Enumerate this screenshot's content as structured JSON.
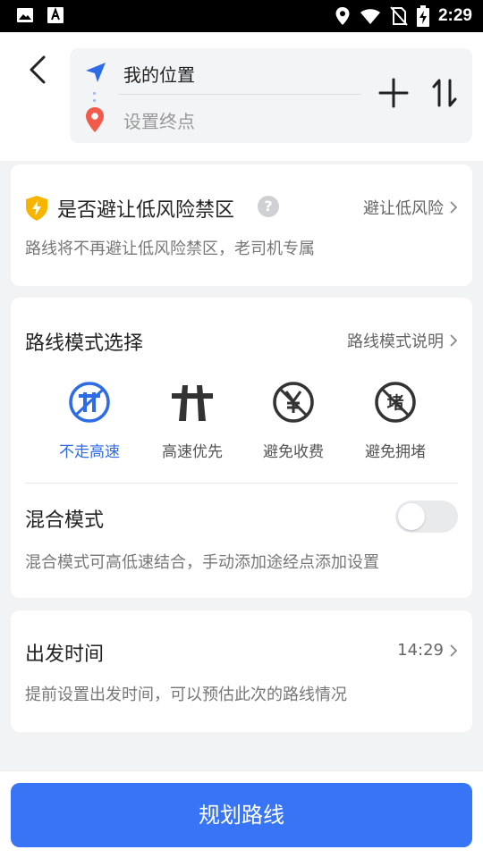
{
  "status_bar": {
    "time": "2:29",
    "icons": [
      "image-icon",
      "text-app-icon",
      "location-icon",
      "wifi-icon",
      "no-sim-icon",
      "battery-charging-icon"
    ]
  },
  "header": {
    "start": "我的位置",
    "end_placeholder": "设置终点"
  },
  "avoid_card": {
    "title": "是否避让低风险禁区",
    "help": "?",
    "link": "避让低风险",
    "desc": "路线将不再避让低风险禁区，老司机专属"
  },
  "mode_card": {
    "title": "路线模式选择",
    "link": "路线模式说明",
    "modes": [
      {
        "label": "不走高速",
        "icon": "no-highway-icon",
        "active": true
      },
      {
        "label": "高速优先",
        "icon": "highway-icon",
        "active": false
      },
      {
        "label": "避免收费",
        "icon": "no-toll-icon",
        "active": false
      },
      {
        "label": "避免拥堵",
        "icon": "no-congestion-icon",
        "active": false
      }
    ],
    "congestion_glyph": "堵",
    "mix_title": "混合模式",
    "mix_on": false,
    "mix_desc": "混合模式可高低速结合，手动添加途经点添加设置"
  },
  "depart_card": {
    "title": "出发时间",
    "time": "14:29",
    "desc": "提前设置出发时间，可以预估此次的路线情况"
  },
  "plan_button": "规划路线",
  "colors": {
    "accent": "#3874f6",
    "active_mode": "#2e6be6",
    "marker_red": "#f25a4a",
    "shield": "#f7b500"
  }
}
